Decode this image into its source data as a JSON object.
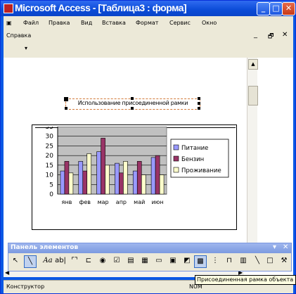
{
  "window": {
    "title": "Microsoft Access - [Таблица3 : форма]",
    "controls": {
      "minimize": "_",
      "maximize": "□",
      "close": "✕"
    }
  },
  "menubar": {
    "items": [
      "Файл",
      "Правка",
      "Вид",
      "Вставка",
      "Формат",
      "Сервис",
      "Окно"
    ],
    "items_row2": [
      "Справка"
    ],
    "mdi_controls": {
      "minimize": "_",
      "restore": "🗗",
      "close": "✕"
    }
  },
  "form": {
    "caption_label": "Использование присоединенной рамки"
  },
  "chart_data": {
    "type": "bar",
    "title": "",
    "xlabel": "",
    "ylabel": "",
    "categories": [
      "янв",
      "фев",
      "мар",
      "апр",
      "май",
      "июн"
    ],
    "y_ticks": [
      "35",
      "30",
      "25",
      "20",
      "15",
      "10",
      "5",
      "0"
    ],
    "ylim": [
      0,
      35
    ],
    "series": [
      {
        "name": "Питание",
        "color": "#9999ff",
        "values": [
          12,
          17,
          22,
          16,
          12,
          19
        ]
      },
      {
        "name": "Бензин",
        "color": "#993366",
        "values": [
          17,
          12,
          29,
          11,
          17,
          20
        ]
      },
      {
        "name": "Проживание",
        "color": "#ffffcc",
        "values": [
          11,
          21,
          15,
          17,
          10,
          10
        ]
      }
    ],
    "legend": "right",
    "plot_bg": "#c0c0c0"
  },
  "palette": {
    "title": "Панель элементов",
    "controls": {
      "menu": "▾",
      "close": "✕"
    },
    "tool_icons": [
      "pointer-icon",
      "wizard-icon",
      "label-icon",
      "textbox-icon",
      "option-group-icon",
      "toggle-button-icon",
      "option-button-icon",
      "checkbox-icon",
      "combobox-icon",
      "listbox-icon",
      "command-button-icon",
      "image-icon",
      "unbound-frame-icon",
      "bound-frame-icon",
      "page-break-icon",
      "tab-control-icon",
      "subform-icon",
      "line-icon",
      "rectangle-icon",
      "more-controls-icon"
    ]
  },
  "statusbar": {
    "mode": "Конструктор",
    "num": "NUM",
    "tooltip": "Присоединенная рамка объекта"
  }
}
